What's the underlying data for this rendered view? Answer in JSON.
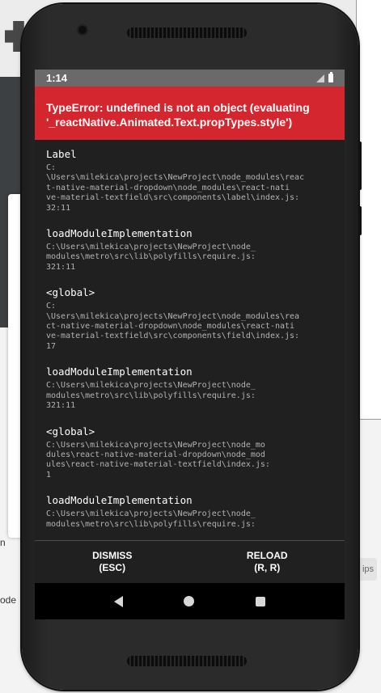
{
  "background": {
    "left_texts": [
      "n",
      "ode"
    ],
    "tips_label": "ips"
  },
  "statusbar": {
    "time": "1:14"
  },
  "error": {
    "title_line1": "TypeError: undefined is not an object (evaluating",
    "title_line2": "'_reactNative.Animated.Text.propTypes.style')"
  },
  "stack": [
    {
      "method": "Label",
      "path": "C:\n\\Users\\milekica\\projects\\NewProject\\node_modules\\reac\nt-native-material-dropdown\\node_modules\\react-nati\nve-material-textfield\\src\\components\\label\\index.js:\n32:11"
    },
    {
      "method": "loadModuleImplementation",
      "path": "C:\\Users\\milekica\\projects\\NewProject\\node_\nmodules\\metro\\src\\lib\\polyfills\\require.js:\n321:11"
    },
    {
      "method": "<global>",
      "path": "C:\n\\Users\\milekica\\projects\\NewProject\\node_modules\\rea\nct-native-material-dropdown\\node_modules\\react-nati\nve-material-textfield\\src\\components\\field\\index.js:\n17"
    },
    {
      "method": "loadModuleImplementation",
      "path": "C:\\Users\\milekica\\projects\\NewProject\\node_\nmodules\\metro\\src\\lib\\polyfills\\require.js:\n321:11"
    },
    {
      "method": "<global>",
      "path": "C:\\Users\\milekica\\projects\\NewProject\\node_mo\ndules\\react-native-material-dropdown\\node_mod\nules\\react-native-material-textfield\\index.js:\n1"
    },
    {
      "method": "loadModuleImplementation",
      "path": "C:\\Users\\milekica\\projects\\NewProject\\node_\nmodules\\metro\\src\\lib\\polyfills\\require.js:"
    }
  ],
  "actions": {
    "dismiss_line1": "DISMISS",
    "dismiss_line2": "(ESC)",
    "reload_line1": "RELOAD",
    "reload_line2": "(R, R)"
  },
  "navbar": {
    "icons": [
      "back-icon",
      "home-icon",
      "recent-apps-icon"
    ]
  },
  "colors": {
    "error_red": "#d3262f",
    "screen_bg": "#202020",
    "statusbar_bg": "#6a6a6a"
  }
}
